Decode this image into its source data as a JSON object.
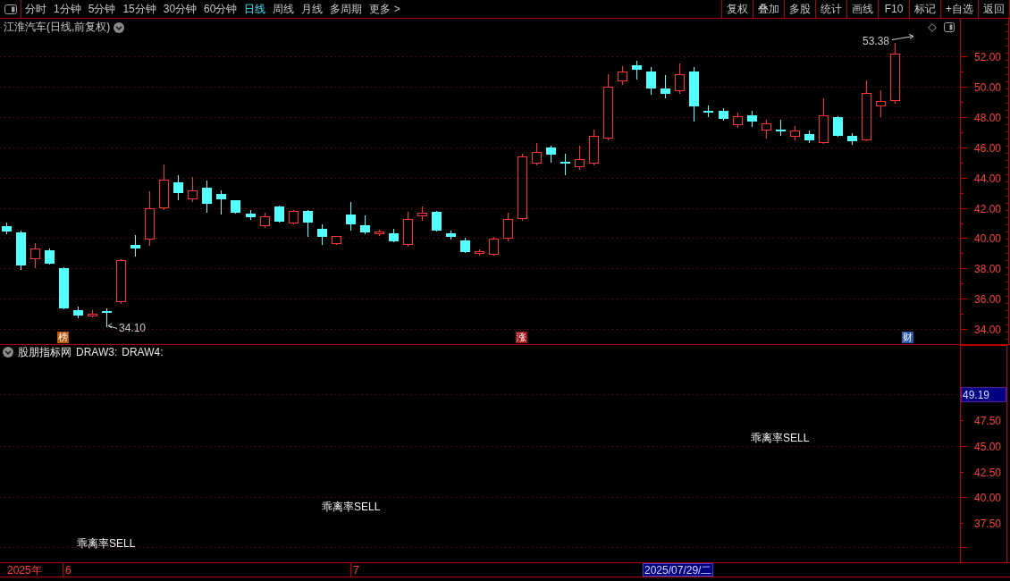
{
  "toolbar": {
    "period_tabs": [
      {
        "label": "分时",
        "selected": false
      },
      {
        "label": "1分钟",
        "selected": false
      },
      {
        "label": "5分钟",
        "selected": false
      },
      {
        "label": "15分钟",
        "selected": false
      },
      {
        "label": "30分钟",
        "selected": false
      },
      {
        "label": "60分钟",
        "selected": false
      },
      {
        "label": "日线",
        "selected": true
      },
      {
        "label": "周线",
        "selected": false
      },
      {
        "label": "月线",
        "selected": false
      },
      {
        "label": "多周期",
        "selected": false
      },
      {
        "label": "更多 >",
        "selected": false
      }
    ],
    "tool_buttons": [
      "复权",
      "叠加",
      "多股",
      "统计",
      "画线",
      "F10",
      "标记",
      "+自选",
      "返回"
    ]
  },
  "price_panel": {
    "title": "江淮汽车(日线,前复权)",
    "axis_labels": [
      "52.00",
      "50.00",
      "48.00",
      "46.00",
      "44.00",
      "42.00",
      "40.00",
      "38.00",
      "36.00",
      "34.00"
    ],
    "extremes": [
      {
        "kind": "low",
        "text": "34.10"
      },
      {
        "kind": "high",
        "text": "53.38"
      }
    ],
    "events": [
      {
        "label": "榜",
        "color": "#b4560a"
      },
      {
        "label": "涨",
        "color": "#a01414"
      },
      {
        "label": "财",
        "color": "#2a5aa8"
      }
    ]
  },
  "indicator_panel": {
    "title": "股朋指标网",
    "fields": [
      "DRAW3:",
      "DRAW4:"
    ],
    "cursor_value": "49.19",
    "axis_labels": [
      "47.50",
      "45.00",
      "42.50",
      "40.00",
      "37.50"
    ],
    "signals": [
      "乖离率SELL",
      "乖离率SELL",
      "乖离率SELL"
    ]
  },
  "time_axis": {
    "year": "2025年",
    "months": [
      "6",
      "7"
    ],
    "cursor_date": "2025/07/29/二"
  }
}
